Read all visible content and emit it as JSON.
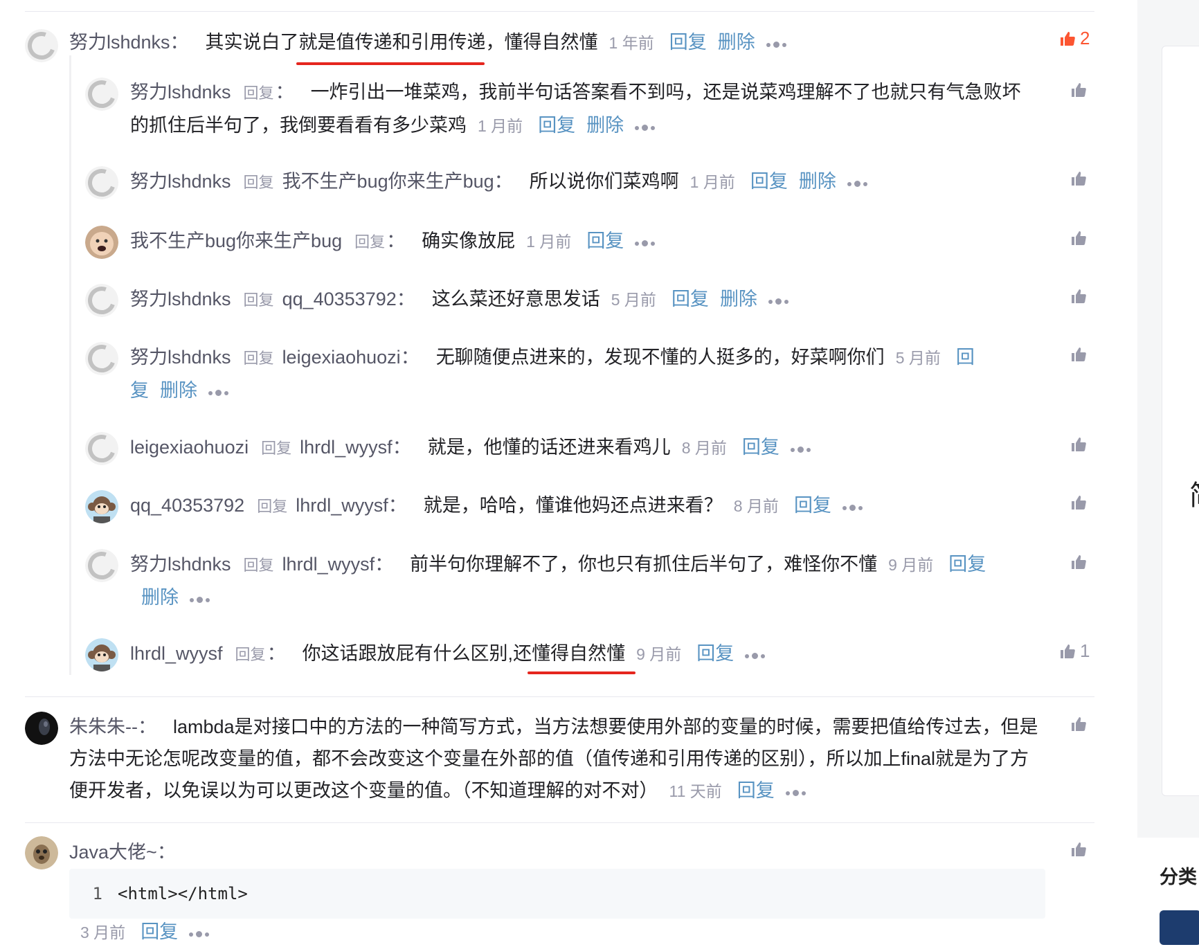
{
  "labels": {
    "reply_to": "回复",
    "reply": "回复",
    "delete": "删除"
  },
  "colors": {
    "accent": "#5893c2",
    "like_active": "#fc5531",
    "underline": "#e5261e"
  },
  "comments": [
    {
      "user": "努力lshdnks",
      "text_before": "其实说白了",
      "text_highlight": "就是值传递和引用传递",
      "text_after": "，懂得自然懂",
      "time": "1 年前",
      "likes": "2",
      "avatar": "c-icon"
    },
    {
      "user": "努力lshdnks",
      "reply_to": "",
      "text": "一炸引出一堆菜鸡，我前半句话答案看不到吗，还是说菜鸡理解不了也就只有气急败坏的抓住后半句了，我倒要看看有多少菜鸡",
      "time": "1 月前",
      "avatar": "c-icon"
    },
    {
      "user": "努力lshdnks",
      "reply_to": "我不生产bug你来生产bug",
      "text": "所以说你们菜鸡啊",
      "time": "1 月前",
      "avatar": "c-icon"
    },
    {
      "user": "我不生产bug你来生产bug",
      "reply_to": "",
      "text": "确实像放屁",
      "time": "1 月前",
      "avatar": "baby-avatar"
    },
    {
      "user": "努力lshdnks",
      "reply_to": "qq_40353792",
      "text": "这么菜还好意思发话",
      "time": "5 月前",
      "avatar": "c-icon"
    },
    {
      "user": "努力lshdnks",
      "reply_to": "leigexiaohuozi",
      "text": "无聊随便点进来的，发现不懂的人挺多的，好菜啊你们",
      "time": "5 月前",
      "avatar": "c-icon"
    },
    {
      "user": "leigexiaohuozi",
      "reply_to": "lhrdl_wyysf",
      "text": "就是，他懂的话还进来看鸡儿",
      "time": "8 月前",
      "avatar": "c-icon"
    },
    {
      "user": "qq_40353792",
      "reply_to": "lhrdl_wyysf",
      "text": "就是，哈哈，懂谁他妈还点进来看？",
      "time": "8 月前",
      "avatar": "monkey-avatar"
    },
    {
      "user": "努力lshdnks",
      "reply_to": "lhrdl_wyysf",
      "text": "前半句你理解不了，你也只有抓住后半句了，难怪你不懂",
      "time": "9 月前",
      "avatar": "c-icon"
    },
    {
      "user": "lhrdl_wyysf",
      "reply_to": "",
      "text_before": "你这话跟放屁有什么区别,",
      "text_highlight": "还懂得自然懂",
      "time": "9 月前",
      "likes": "1",
      "avatar": "monkey-avatar"
    },
    {
      "user": "朱朱朱--",
      "text": "lambda是对接口中的方法的一种简写方式，当方法想要使用外部的变量的时候，需要把值给传过去，但是方法中无论怎呢改变量的值，都不会改变这个变量在外部的值（值传递和引用传递的区别），所以加上final就是为了方便开发者，以免误以为可以更改这个变量的值。（不知道理解的对不对）",
      "time": "11 天前",
      "avatar": "dark-avatar"
    },
    {
      "user": "Java大佬~",
      "code_line_number": "1",
      "code": "<html></html>",
      "time": "3 月前",
      "avatar": "meerkat-avatar"
    }
  ],
  "sidebar": {
    "partial_text": "简",
    "section_title": "分类"
  }
}
